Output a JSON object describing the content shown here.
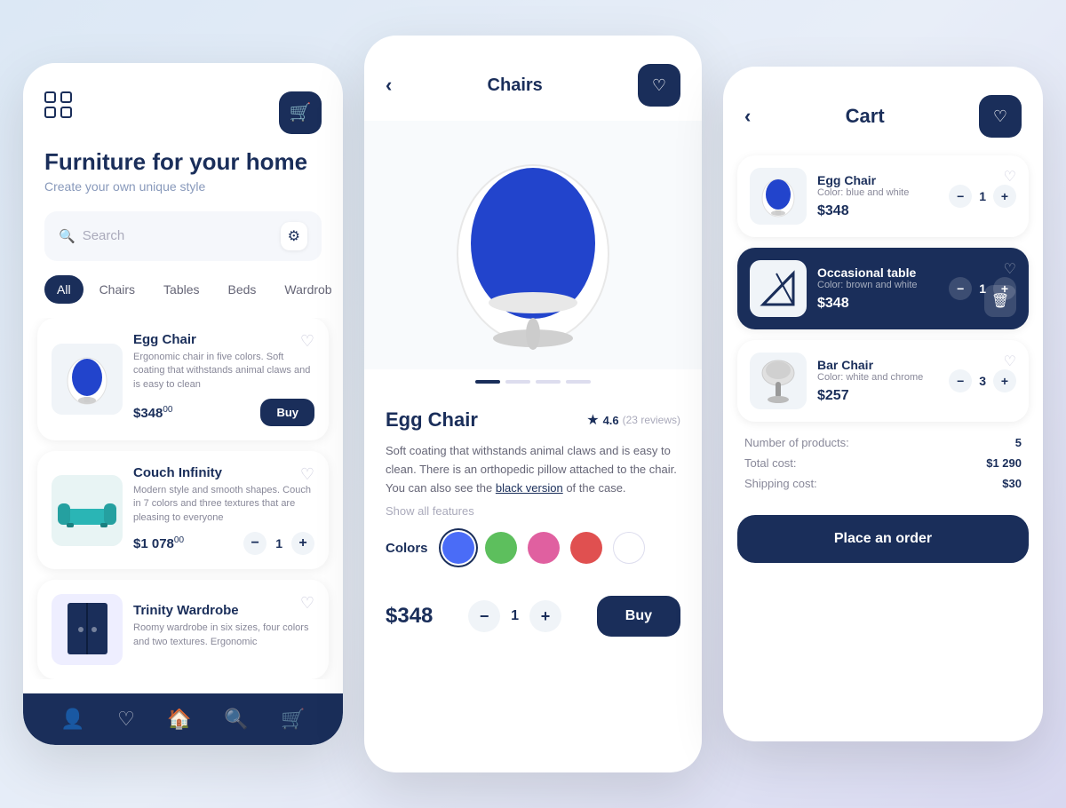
{
  "app": {
    "title": "Furniture for your home",
    "subtitle": "Create your own unique style"
  },
  "screen1": {
    "cart_icon": "🛒",
    "search_placeholder": "Search",
    "categories": [
      {
        "label": "All",
        "active": true
      },
      {
        "label": "Chairs",
        "active": false
      },
      {
        "label": "Tables",
        "active": false
      },
      {
        "label": "Beds",
        "active": false
      },
      {
        "label": "Wardrob",
        "active": false
      }
    ],
    "products": [
      {
        "name": "Egg Chair",
        "desc": "Ergonomic chair in five colors. Soft coating that withstands animal claws and is easy to clean",
        "price": "$348",
        "cents": "00",
        "action": "buy"
      },
      {
        "name": "Couch Infinity",
        "desc": "Modern style and smooth shapes. Couch in 7 colors and three textures that are pleasing to everyone",
        "price": "$1 078",
        "cents": "00",
        "action": "qty",
        "qty": 1
      },
      {
        "name": "Trinity Wardrobe",
        "desc": "Roomy wardrobe in six sizes, four colors and two textures. Ergonomic",
        "price": "",
        "action": "none"
      }
    ],
    "nav": [
      "👤",
      "♡",
      "🏠",
      "🔍",
      "🛒"
    ]
  },
  "screen2": {
    "title": "Chairs",
    "product_name": "Egg Chair",
    "rating": "4.6",
    "reviews": "(23 reviews)",
    "description": "Soft coating that withstands animal claws and is easy to clean. There is an orthopedic pillow attached to the chair. You can also see the",
    "link_text": "black version",
    "desc_end": "of the case.",
    "show_features": "Show all features",
    "colors_label": "Colors",
    "colors": [
      {
        "color": "#4a6cf7",
        "active": true
      },
      {
        "color": "#5dbf5d",
        "active": false
      },
      {
        "color": "#e060a0",
        "active": false
      },
      {
        "color": "#e05050",
        "active": false
      },
      {
        "color": "#ffffff",
        "active": false
      }
    ],
    "price": "$348",
    "qty": 1,
    "buy_label": "Buy",
    "dots": [
      true,
      false,
      false,
      false
    ]
  },
  "screen3": {
    "title": "Cart",
    "items": [
      {
        "name": "Egg Chair",
        "color": "Color: blue and white",
        "price": "$348",
        "qty": 1,
        "dark": false
      },
      {
        "name": "Occasional table",
        "color": "Color: brown and white",
        "price": "$348",
        "qty": 1,
        "dark": true
      },
      {
        "name": "Bar Chair",
        "color": "Color: white and chrome",
        "price": "$257",
        "qty": 3,
        "dark": false
      }
    ],
    "summary": {
      "products_label": "Number of products:",
      "products_val": "5",
      "total_label": "Total cost:",
      "total_val": "$1 290",
      "shipping_label": "Shipping cost:",
      "shipping_val": "$30"
    },
    "place_order_label": "Place an order"
  }
}
